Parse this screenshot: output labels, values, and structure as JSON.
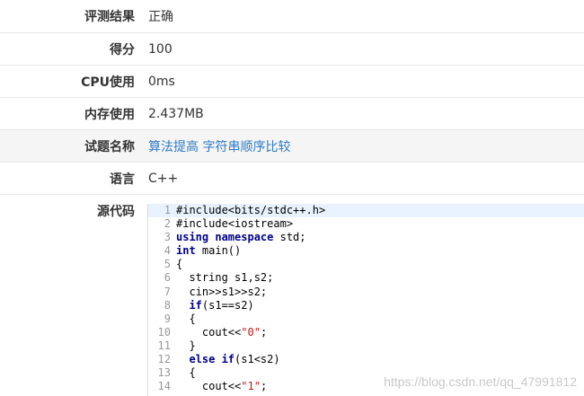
{
  "rows": [
    {
      "label": "评测结果",
      "value": "正确"
    },
    {
      "label": "得分",
      "value": "100"
    },
    {
      "label": "CPU使用",
      "value": "0ms"
    },
    {
      "label": "内存使用",
      "value": "2.437MB"
    },
    {
      "label": "试题名称",
      "value": "算法提高 字符串顺序比较"
    },
    {
      "label": "语言",
      "value": "C++"
    }
  ],
  "source_label": "源代码",
  "code": [
    {
      "n": "1",
      "segs": [
        {
          "t": "#include<bits/stdc++.h>",
          "c": "txt"
        }
      ]
    },
    {
      "n": "2",
      "segs": [
        {
          "t": "#include<iostream>",
          "c": "txt"
        }
      ]
    },
    {
      "n": "3",
      "segs": [
        {
          "t": "using namespace",
          "c": "kw"
        },
        {
          "t": " std;",
          "c": "txt"
        }
      ]
    },
    {
      "n": "4",
      "segs": [
        {
          "t": "int",
          "c": "kw"
        },
        {
          "t": " main()",
          "c": "txt"
        }
      ]
    },
    {
      "n": "5",
      "segs": [
        {
          "t": "{",
          "c": "txt"
        }
      ]
    },
    {
      "n": "6",
      "segs": [
        {
          "t": "  string s1,s2;",
          "c": "txt"
        }
      ]
    },
    {
      "n": "7",
      "segs": [
        {
          "t": "  cin>>s1>>s2;",
          "c": "txt"
        }
      ]
    },
    {
      "n": "8",
      "segs": [
        {
          "t": "  ",
          "c": "txt"
        },
        {
          "t": "if",
          "c": "kw"
        },
        {
          "t": "(s1==s2)",
          "c": "txt"
        }
      ]
    },
    {
      "n": "9",
      "segs": [
        {
          "t": "  {",
          "c": "txt"
        }
      ]
    },
    {
      "n": "10",
      "segs": [
        {
          "t": "    cout<<",
          "c": "txt"
        },
        {
          "t": "\"0\"",
          "c": "str"
        },
        {
          "t": ";",
          "c": "txt"
        }
      ]
    },
    {
      "n": "11",
      "segs": [
        {
          "t": "  }",
          "c": "txt"
        }
      ]
    },
    {
      "n": "12",
      "segs": [
        {
          "t": "  ",
          "c": "txt"
        },
        {
          "t": "else if",
          "c": "kw"
        },
        {
          "t": "(s1<s2)",
          "c": "txt"
        }
      ]
    },
    {
      "n": "13",
      "segs": [
        {
          "t": "  {",
          "c": "txt"
        }
      ]
    },
    {
      "n": "14",
      "segs": [
        {
          "t": "    cout<<",
          "c": "txt"
        },
        {
          "t": "\"1\"",
          "c": "str"
        },
        {
          "t": ";",
          "c": "txt"
        }
      ]
    }
  ],
  "watermark": "https://blog.csdn.net/qq_47991812"
}
